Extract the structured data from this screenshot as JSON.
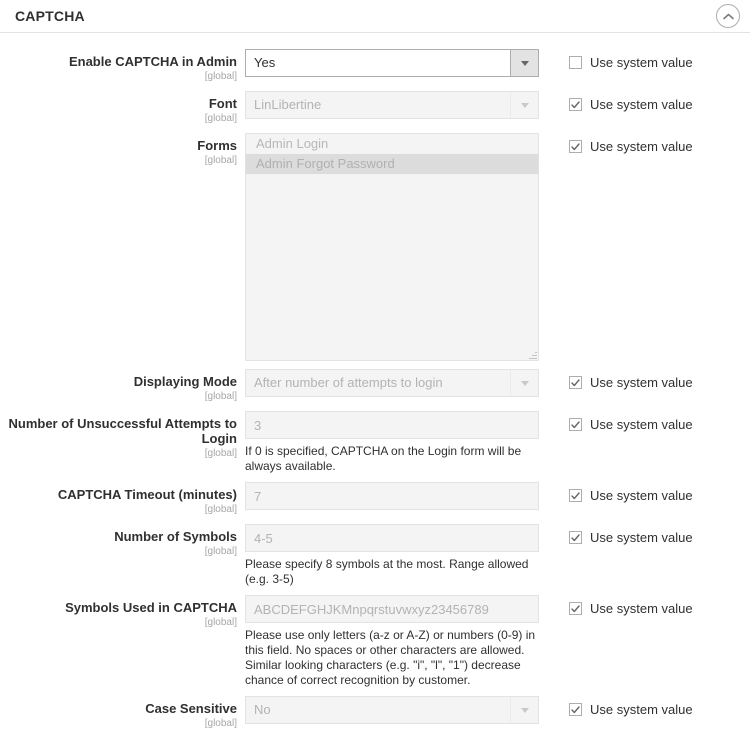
{
  "section": {
    "title": "CAPTCHA",
    "collapse_icon": "chevron-up-circle-icon"
  },
  "system_value_label": "Use system value",
  "scope_label": "[global]",
  "fields": [
    {
      "label": "Enable CAPTCHA in Admin",
      "scope": "[global]",
      "type": "select",
      "value": "Yes",
      "disabled": false,
      "use_system_value": false,
      "note": ""
    },
    {
      "label": "Font",
      "scope": "[global]",
      "type": "select",
      "value": "LinLibertine",
      "disabled": true,
      "use_system_value": true,
      "note": ""
    },
    {
      "label": "Forms",
      "scope": "[global]",
      "type": "multiselect",
      "options": [
        {
          "label": "Admin Login",
          "selected": false
        },
        {
          "label": "Admin Forgot Password",
          "selected": true
        }
      ],
      "disabled": true,
      "use_system_value": true,
      "note": ""
    },
    {
      "label": "Displaying Mode",
      "scope": "[global]",
      "type": "select",
      "value": "After number of attempts to login",
      "disabled": true,
      "use_system_value": true,
      "note": ""
    },
    {
      "label": "Number of Unsuccessful Attempts to Login",
      "scope": "[global]",
      "type": "input",
      "value": "3",
      "disabled": true,
      "use_system_value": true,
      "note": "If 0 is specified, CAPTCHA on the Login form will be always available."
    },
    {
      "label": "CAPTCHA Timeout (minutes)",
      "scope": "[global]",
      "type": "input",
      "value": "7",
      "disabled": true,
      "use_system_value": true,
      "note": ""
    },
    {
      "label": "Number of Symbols",
      "scope": "[global]",
      "type": "input",
      "value": "4-5",
      "disabled": true,
      "use_system_value": true,
      "note": "Please specify 8 symbols at the most. Range allowed (e.g. 3-5)"
    },
    {
      "label": "Symbols Used in CAPTCHA",
      "scope": "[global]",
      "type": "input",
      "value": "ABCDEFGHJKMnpqrstuvwxyz23456789",
      "disabled": true,
      "use_system_value": true,
      "note": "Please use only letters (a-z or A-Z) or numbers (0-9) in this field. No spaces or other characters are allowed.\nSimilar looking characters (e.g. \"i\", \"l\", \"1\") decrease chance of correct recognition by customer."
    },
    {
      "label": "Case Sensitive",
      "scope": "[global]",
      "type": "select",
      "value": "No",
      "disabled": true,
      "use_system_value": true,
      "note": ""
    }
  ],
  "colors": {
    "text": "#303030",
    "muted": "#b3b3b3",
    "border": "#e3e3e3",
    "border_strong": "#adadad",
    "disabled_bg": "#f4f4f4",
    "selected_bg": "#dcdcdc"
  }
}
